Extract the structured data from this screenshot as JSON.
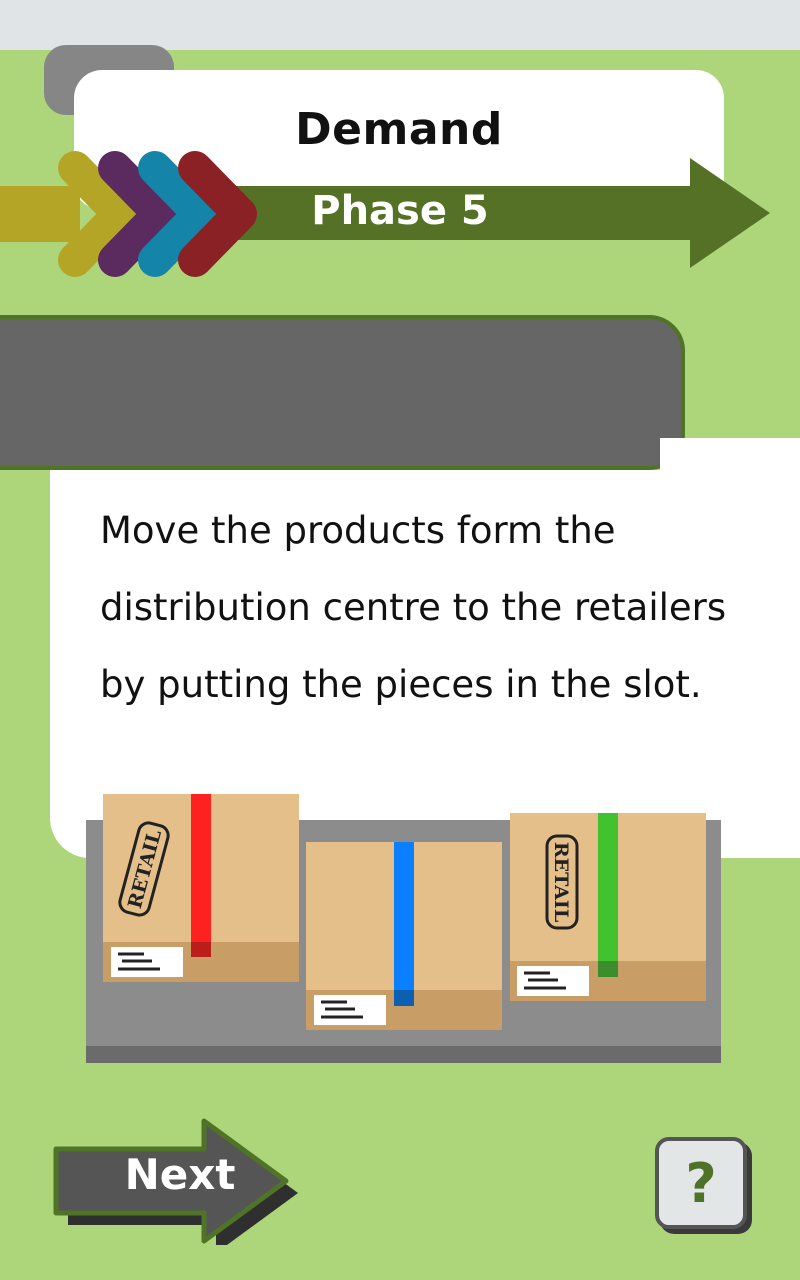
{
  "header": {
    "title": "Demand",
    "phase": "Phase 5"
  },
  "instruction": "Move the products form the distribution centre to the retailers by putting the pieces in the slot.",
  "boxes": [
    {
      "stamp": "RETAIL",
      "tape_color": "#ff2020"
    },
    {
      "stamp": "",
      "tape_color": "#0a7fff"
    },
    {
      "stamp": "RETAIL",
      "tape_color": "#43c22f"
    }
  ],
  "buttons": {
    "next_label": "Next",
    "help_label": "?"
  },
  "colors": {
    "background": "#add67b",
    "phase_arrow": "#557126",
    "arrow_yellow": "#b5a527",
    "arrow_purple": "#5b2a5f",
    "arrow_blue": "#1584a9",
    "arrow_red": "#8a2125"
  }
}
